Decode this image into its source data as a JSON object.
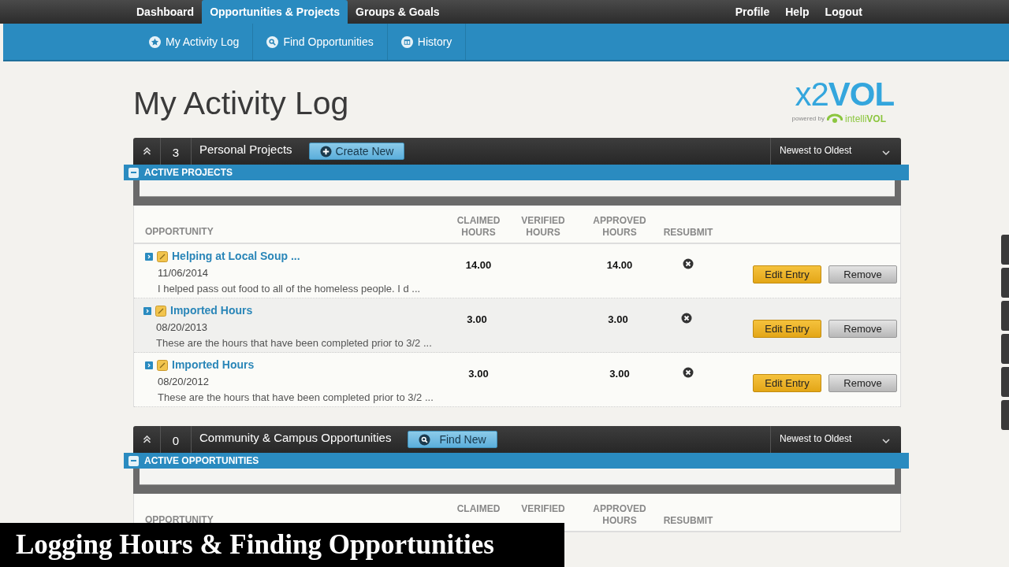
{
  "top_nav": {
    "left": [
      {
        "label": "Dashboard",
        "selected": false
      },
      {
        "label": "Opportunities & Projects",
        "selected": true
      },
      {
        "label": "Groups & Goals",
        "selected": false
      }
    ],
    "right": [
      "Profile",
      "Help",
      "Logout"
    ]
  },
  "sub_nav": [
    "My Activity Log",
    "Find Opportunities",
    "History"
  ],
  "page_title": "My Activity Log",
  "logo": {
    "name": "x2**VOL**",
    "powered_by": "powered by",
    "brand": "intelli**VOL**"
  },
  "sections": [
    {
      "count": "3",
      "title": "Personal Projects",
      "action": "Create New",
      "sort": "Newest to Oldest",
      "group": "ACTIVE PROJECTS",
      "columns": [
        "OPPORTUNITY",
        "CLAIMED HOURS",
        "VERIFIED HOURS",
        "APPROVED HOURS",
        "RESUBMIT"
      ],
      "rows": [
        {
          "title": "Helping at Local Soup ...",
          "date": "11/06/2014",
          "description": "I helped pass out food to all of the homeless people. I d ...",
          "claimed": "14.00",
          "approved": "14.00",
          "hovered": false,
          "buttons": [
            "Edit Entry",
            "Remove"
          ]
        },
        {
          "title": "Imported Hours",
          "date": "08/20/2013",
          "description": "These are the hours that have been completed prior to 3/2 ...",
          "claimed": "3.00",
          "approved": "3.00",
          "hovered": true,
          "buttons": [
            "Edit Entry",
            "Remove"
          ]
        },
        {
          "title": "Imported Hours",
          "date": "08/20/2012",
          "description": "These are the hours that have been completed prior to 3/2 ...",
          "claimed": "3.00",
          "approved": "3.00",
          "hovered": false,
          "buttons": [
            "Edit Entry",
            "Remove"
          ]
        }
      ]
    },
    {
      "count": "0",
      "title": "Community & Campus Opportunities",
      "action": "Find New",
      "sort": "Newest to Oldest",
      "group": "ACTIVE OPPORTUNITIES",
      "columns": [
        "OPPORTUNITY",
        "CLAIMED",
        "VERIFIED",
        "APPROVED HOURS",
        "RESUBMIT"
      ]
    }
  ],
  "caption": "Logging Hours & Finding Opportunities"
}
